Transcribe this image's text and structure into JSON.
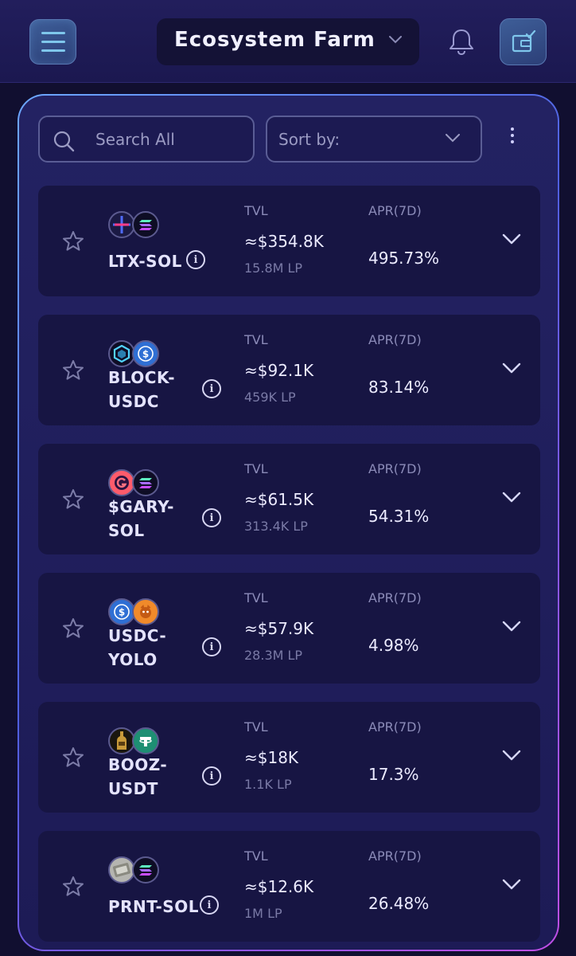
{
  "header": {
    "title": "Ecosystem Farm",
    "menu_icon": "hamburger-icon",
    "notifications_icon": "bell-icon",
    "wallet_icon": "wallet-icon"
  },
  "filters": {
    "search_placeholder": "Search All",
    "sort_label": "Sort by:"
  },
  "columns": {
    "tvl": "TVL",
    "apr": "APR(7D)"
  },
  "farms": [
    {
      "pair_line1": "LTX-SOL",
      "pair_line2": "",
      "tvl": "≈$354.8K",
      "lp": "15.8M LP",
      "apr": "495.73%",
      "token_a": "LTX",
      "token_b": "SOL"
    },
    {
      "pair_line1": "BLOCK-",
      "pair_line2": "USDC",
      "tvl": "≈$92.1K",
      "lp": "459K LP",
      "apr": "83.14%",
      "token_a": "BLOCK",
      "token_b": "USDC"
    },
    {
      "pair_line1": "$GARY-",
      "pair_line2": "SOL",
      "tvl": "≈$61.5K",
      "lp": "313.4K LP",
      "apr": "54.31%",
      "token_a": "GARY",
      "token_b": "SOL"
    },
    {
      "pair_line1": "USDC-",
      "pair_line2": "YOLO",
      "tvl": "≈$57.9K",
      "lp": "28.3M LP",
      "apr": "4.98%",
      "token_a": "USDC",
      "token_b": "YOLO"
    },
    {
      "pair_line1": "BOOZ-",
      "pair_line2": "USDT",
      "tvl": "≈$18K",
      "lp": "1.1K LP",
      "apr": "17.3%",
      "token_a": "BOOZ",
      "token_b": "USDT"
    },
    {
      "pair_line1": "PRNT-SOL",
      "pair_line2": "",
      "tvl": "≈$12.6K",
      "lp": "1M LP",
      "apr": "26.48%",
      "token_a": "PRNT",
      "token_b": "SOL"
    }
  ],
  "colors": {
    "background": "#110f30",
    "panel": "#1f1d59",
    "card": "#171543",
    "accent": "#7fc7ec"
  }
}
